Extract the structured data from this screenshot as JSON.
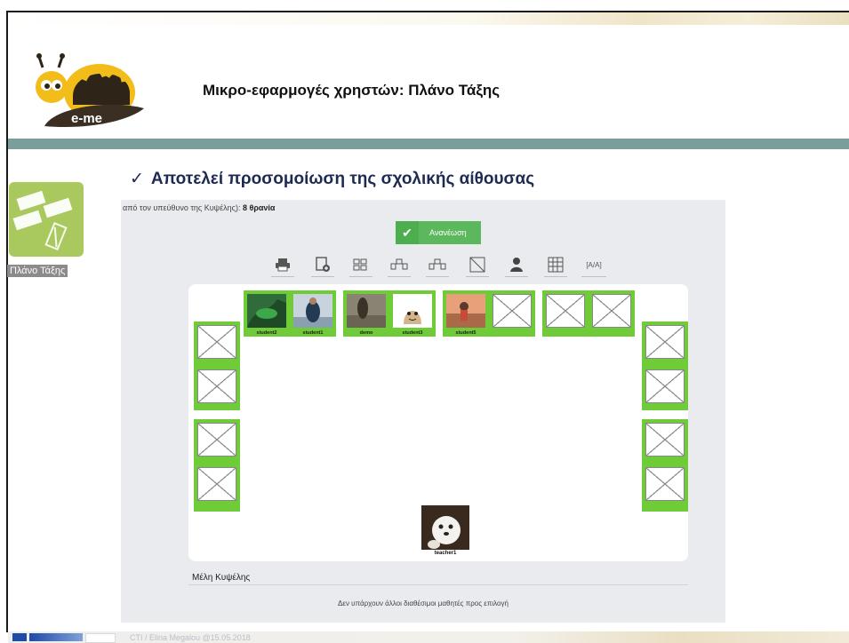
{
  "slide": {
    "title": "Μικρο-εφαρμογές χρηστών:  Πλάνο Τάξης",
    "bullet": "Αποτελεί προσομοίωση της σχολικής αίθουσας",
    "logo_text": "e-me",
    "footer": "CTI / Elina Megalou @15.05.2018"
  },
  "app_icon": {
    "label": "Πλάνο Τάξης",
    "icon": "seating-plan-icon"
  },
  "screenshot": {
    "top_text": "από τον υπεύθυνο της Κυψέλης): ",
    "top_count": "8 θρανία",
    "refresh_label": "Ανανέωση",
    "toolbar": [
      {
        "name": "print",
        "glyph": "🖶"
      },
      {
        "name": "add-desk",
        "glyph": "⊕"
      },
      {
        "name": "layout-grid",
        "glyph": "▦"
      },
      {
        "name": "layout-pairs",
        "glyph": "⊞"
      },
      {
        "name": "layout-groups",
        "glyph": "⊟"
      },
      {
        "name": "clear-desk",
        "glyph": "◩"
      },
      {
        "name": "student",
        "glyph": "👤"
      },
      {
        "name": "table",
        "glyph": "▦"
      },
      {
        "name": "font-size",
        "glyph": "[A/A]"
      }
    ],
    "students": {
      "s1": "student2",
      "s2": "student1",
      "s3": "demo",
      "s4": "student3",
      "s5": "student5"
    },
    "teacher": "teacher1",
    "members_title": "Μέλη Κυψέλης",
    "members_empty": "Δεν υπάρχουν άλλοι διαθέσιμοι μαθητές προς επιλογή"
  },
  "colors": {
    "accent_green": "#6fcb38",
    "teal_bar": "#7a9f9a",
    "bullet_text": "#1d2a52",
    "refresh": "#5cb85c"
  }
}
